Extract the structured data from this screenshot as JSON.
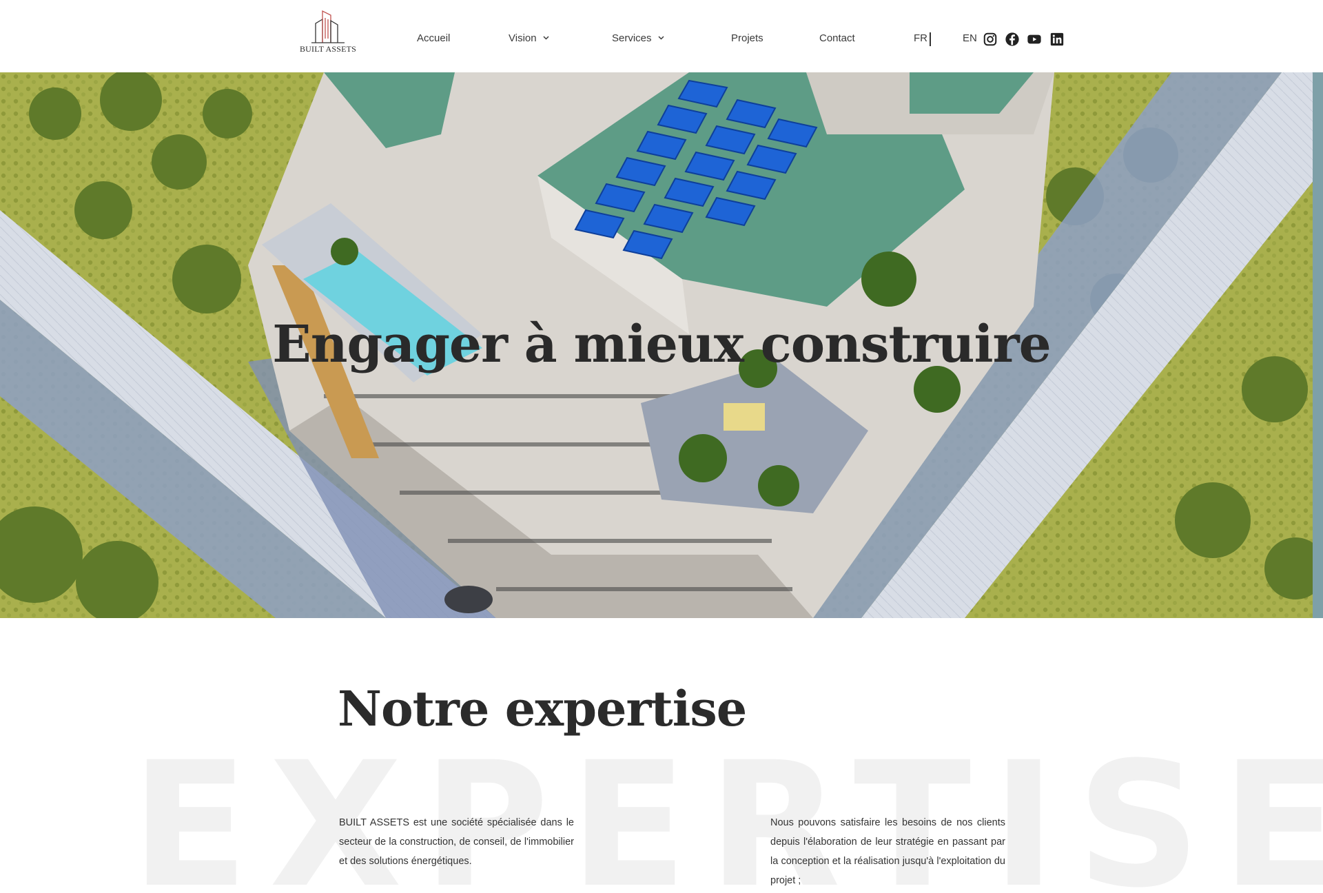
{
  "brand": {
    "name": "BUILT ASSETS"
  },
  "nav": {
    "items": [
      {
        "label": "Accueil",
        "has_dropdown": false
      },
      {
        "label": "Vision",
        "has_dropdown": true
      },
      {
        "label": "Services",
        "has_dropdown": true
      },
      {
        "label": "Projets",
        "has_dropdown": false
      },
      {
        "label": "Contact",
        "has_dropdown": false
      }
    ],
    "languages": [
      {
        "label": "FR"
      },
      {
        "label": "EN"
      }
    ],
    "social_icons": [
      "instagram-icon",
      "facebook-icon",
      "youtube-icon",
      "linkedin-icon"
    ]
  },
  "hero": {
    "title": "Engager à mieux construire"
  },
  "expertise": {
    "title": "Notre expertise",
    "background_word": "EXPERTISE",
    "left_text": "BUILT ASSETS est une société spécialisée dans le secteur de la construction, de conseil, de l'immobilier et des solutions énergétiques.",
    "right_text": "Nous pouvons satisfaire les besoins de nos clients depuis l'élaboration de leur stratégie en passant par la conception et la réalisation jusqu'à l'exploitation du projet ;"
  },
  "colors": {
    "text": "#2b2b2b",
    "logo_accent": "#c0504d",
    "bg_word": "#f1f1f1"
  }
}
